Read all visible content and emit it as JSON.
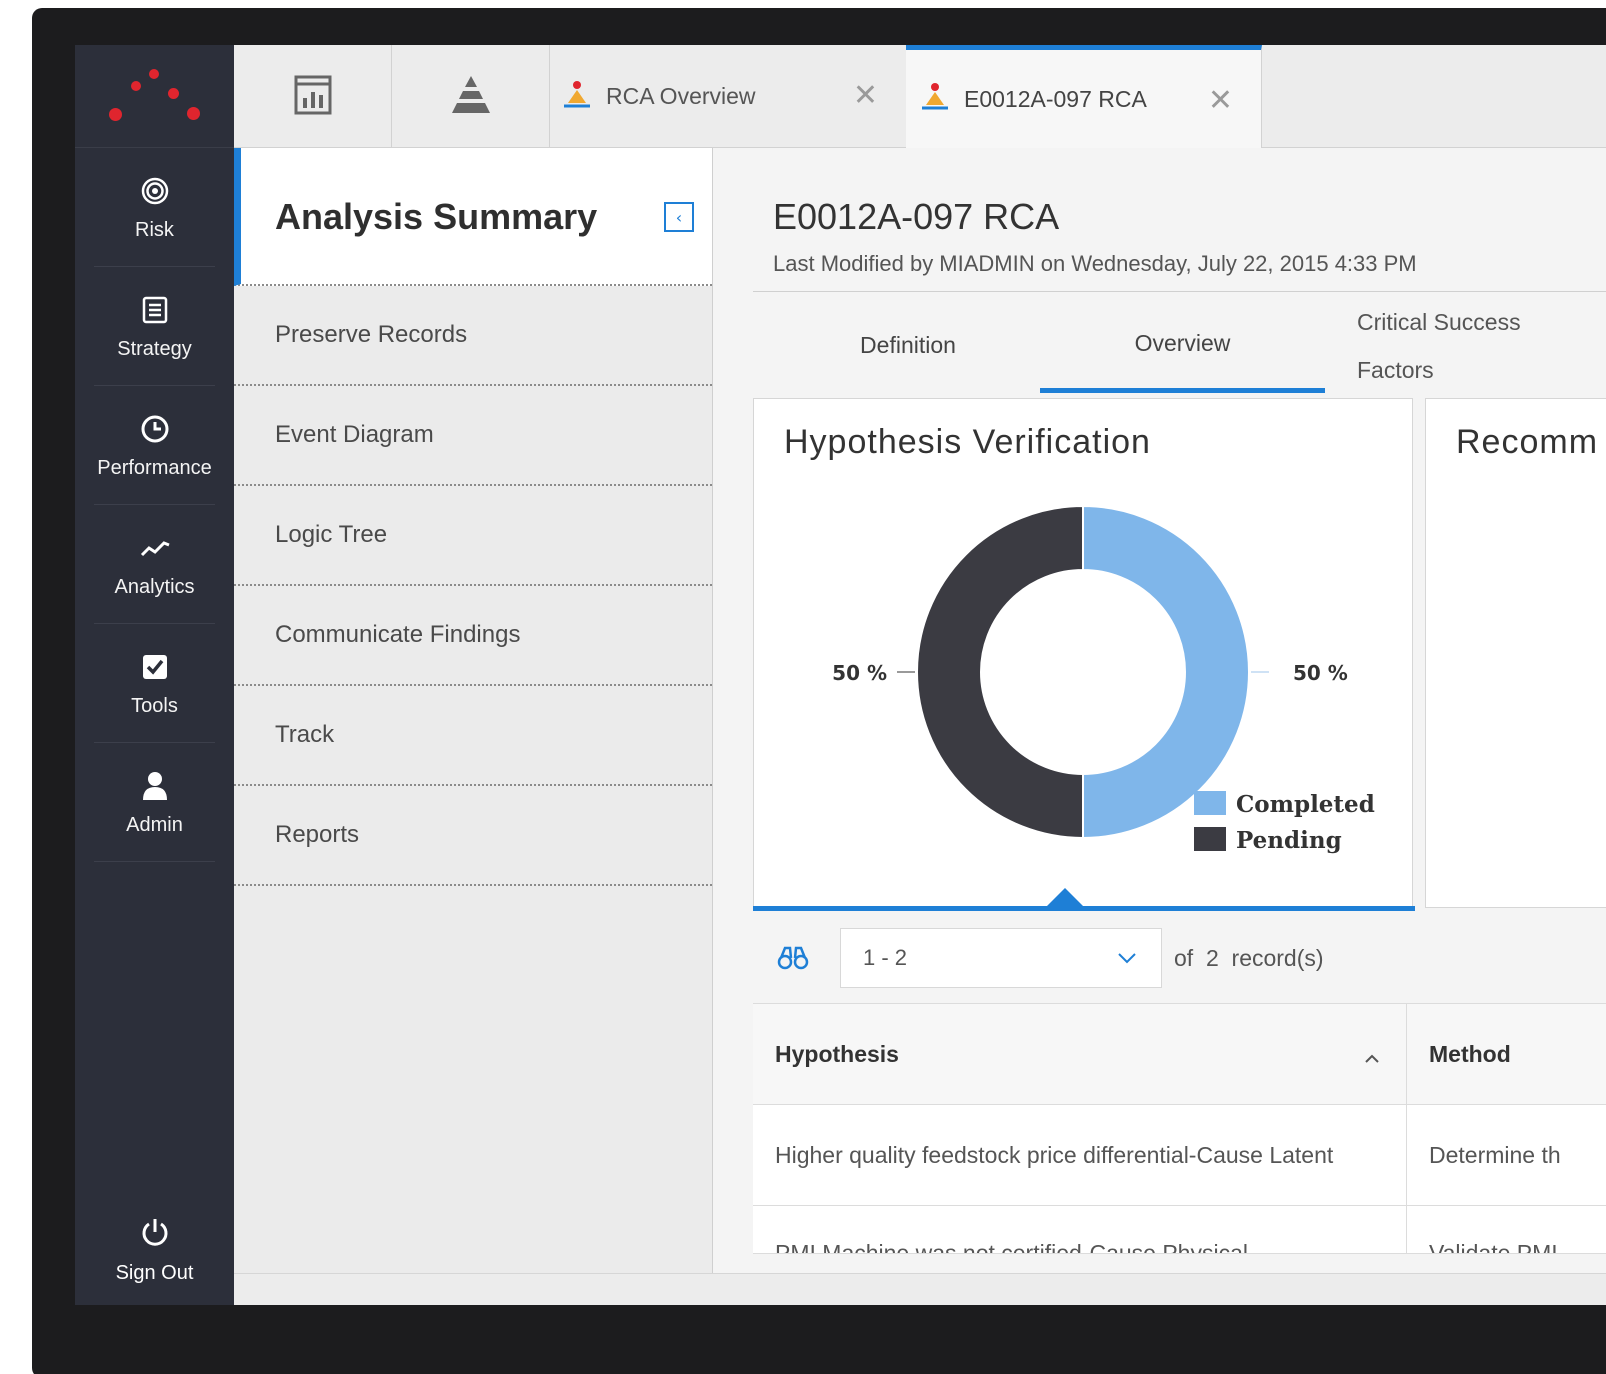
{
  "nav": {
    "items": [
      {
        "label": "Risk",
        "icon": "target-icon"
      },
      {
        "label": "Strategy",
        "icon": "list-icon"
      },
      {
        "label": "Performance",
        "icon": "clock-icon"
      },
      {
        "label": "Analytics",
        "icon": "trend-icon"
      },
      {
        "label": "Tools",
        "icon": "checkbox-icon"
      },
      {
        "label": "Admin",
        "icon": "user-icon"
      }
    ],
    "signout": "Sign Out"
  },
  "tabs": {
    "rca_overview": "RCA Overview",
    "active": "E0012A-097 RCA",
    "close": "✕"
  },
  "summary": {
    "title": "Analysis Summary",
    "items": [
      "Preserve Records",
      "Event Diagram",
      "Logic Tree",
      "Communicate Findings",
      "Track",
      "Reports"
    ]
  },
  "record": {
    "title": "E0012A-097 RCA",
    "subtitle": "Last Modified by MIADMIN on Wednesday, July 22, 2015 4:33 PM"
  },
  "subtabs": {
    "definition": "Definition",
    "overview": "Overview",
    "csf_line1": "Critical Success",
    "csf_line2": "Factors"
  },
  "cards": {
    "hypothesis": "Hypothesis Verification",
    "recommendations": "Recomm"
  },
  "chart_data": {
    "type": "pie",
    "donut": true,
    "title": "Hypothesis Verification",
    "labels": [
      "Completed",
      "Pending"
    ],
    "values": [
      50,
      50
    ],
    "data_labels": [
      "50 %",
      "50 %"
    ],
    "colors": [
      "#7fb6ea",
      "#3b3b42"
    ],
    "legend": "bottom-right"
  },
  "pager": {
    "range": "1 - 2",
    "count": "of  2  record(s)"
  },
  "grid": {
    "headers": [
      "Hypothesis",
      "Method"
    ],
    "rows": [
      [
        "Higher quality feedstock price differential-Cause Latent",
        "Determine th"
      ],
      [
        "PMI Machine was not certified-Cause Physical",
        "Validate PMI"
      ]
    ]
  },
  "colors": {
    "accent": "#1e7fd6",
    "nav_bg": "#2c2f3a",
    "brand_red": "#e0252e"
  }
}
